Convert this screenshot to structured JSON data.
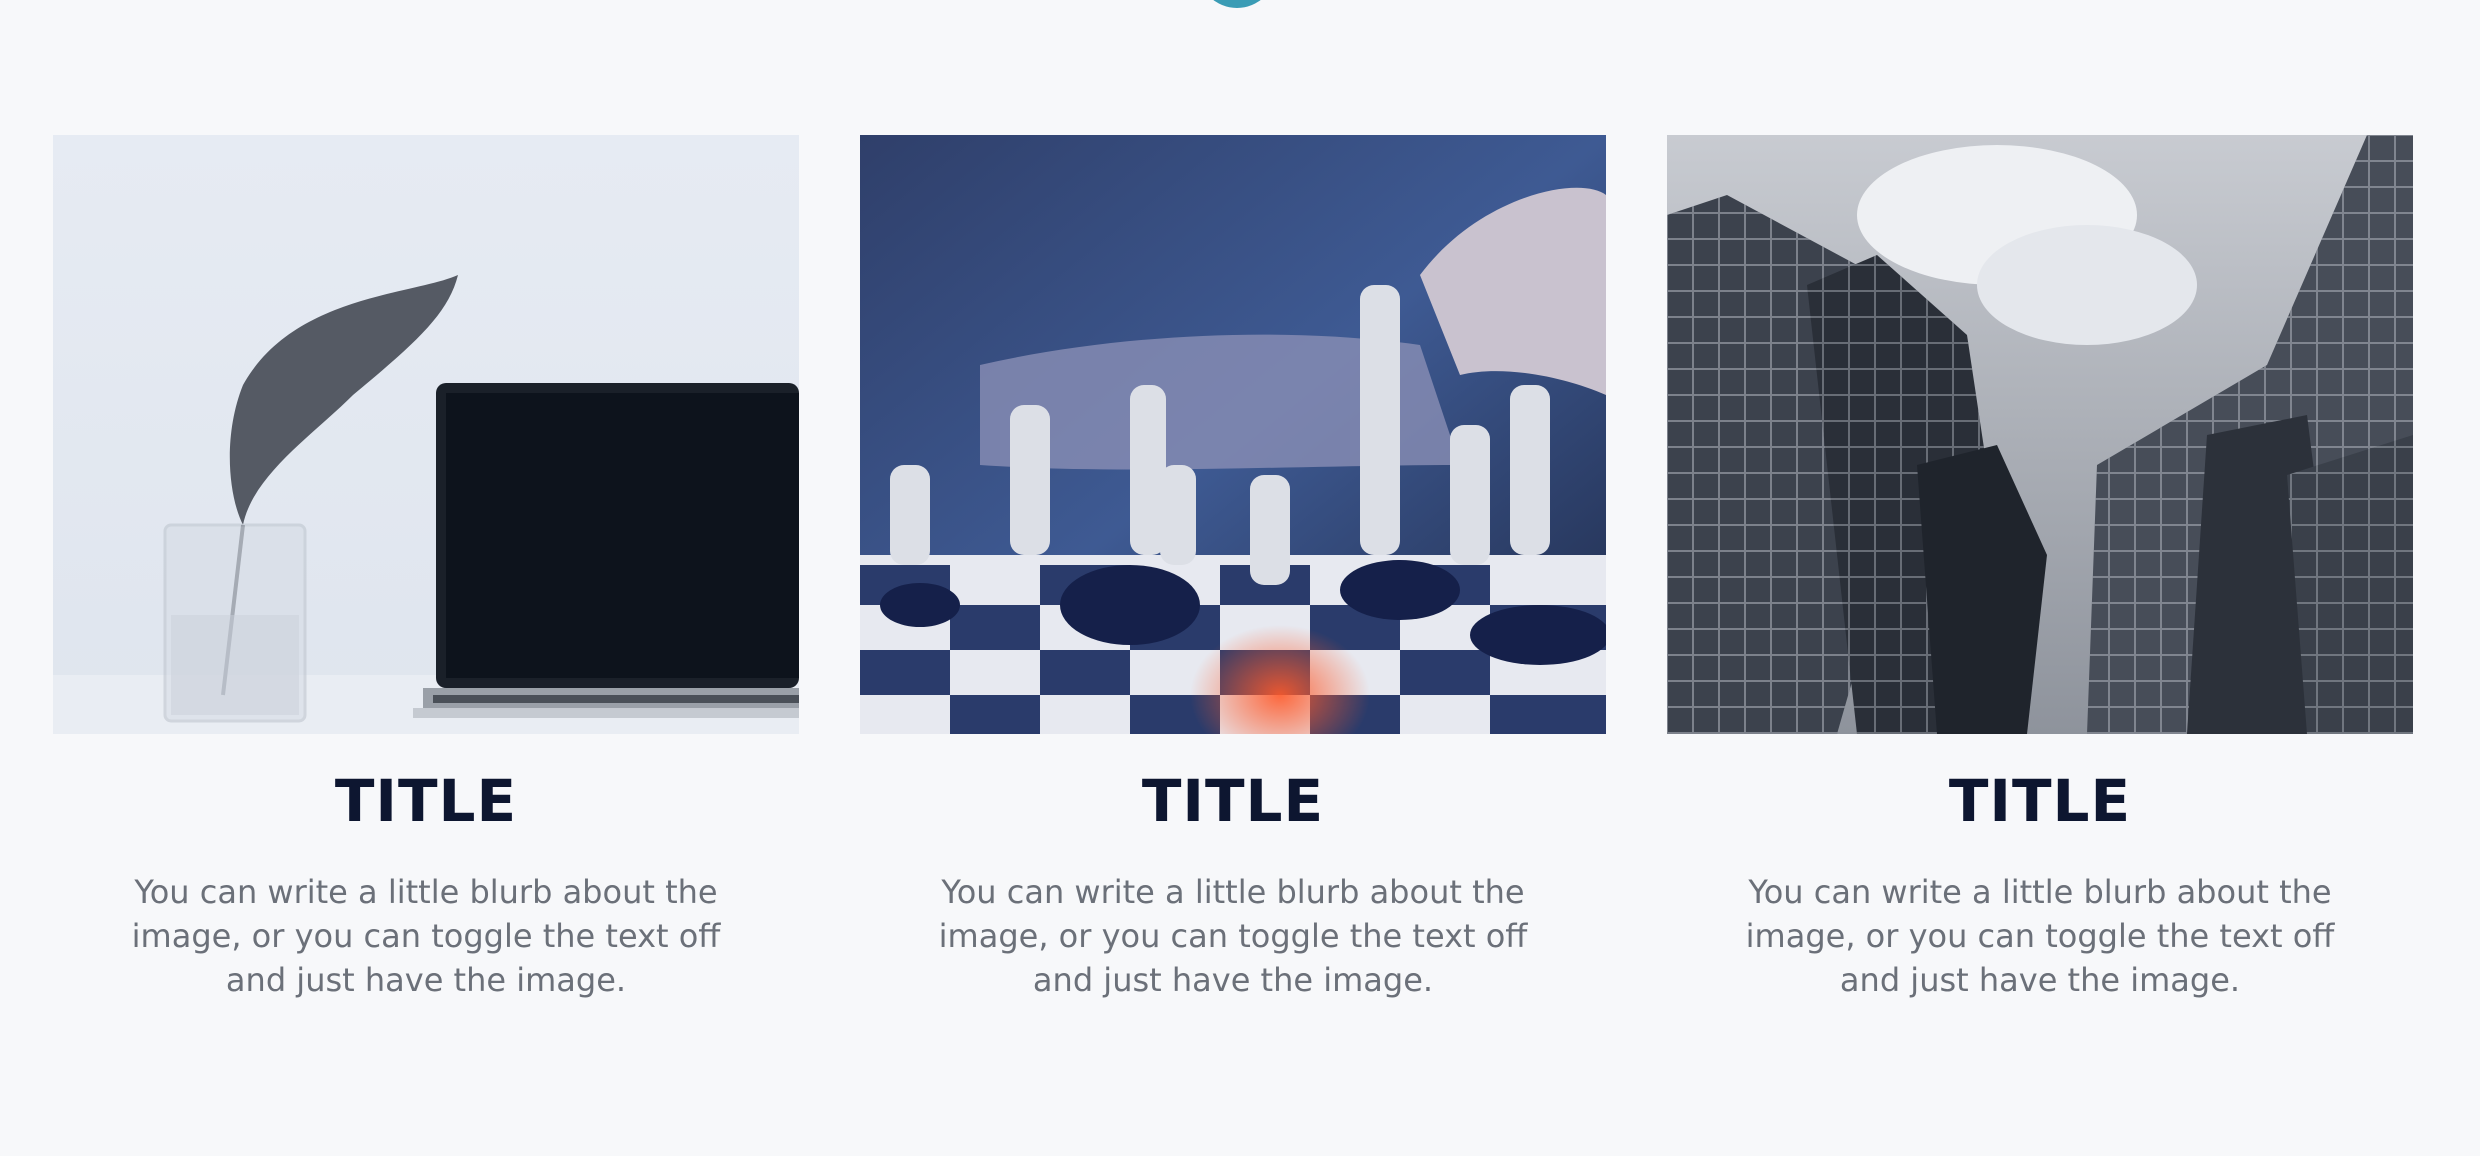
{
  "cards": [
    {
      "image_subject": "laptop-and-leaf-image",
      "title": "TITLE",
      "text": "You can write a little blurb about the image, or you can toggle the text off and just have the image."
    },
    {
      "image_subject": "chess-board-image",
      "title": "TITLE",
      "text": "You can write a little blurb about the image, or you can toggle the text off and just have the image."
    },
    {
      "image_subject": "skyscrapers-image",
      "title": "TITLE",
      "text": "You can write a little blurb about the image, or you can toggle the text off and just have the image."
    }
  ],
  "colors": {
    "background": "#f7f8fa",
    "title": "#0d1630",
    "body_text": "#6b7079",
    "accent_dot": "#3a9cb5"
  }
}
